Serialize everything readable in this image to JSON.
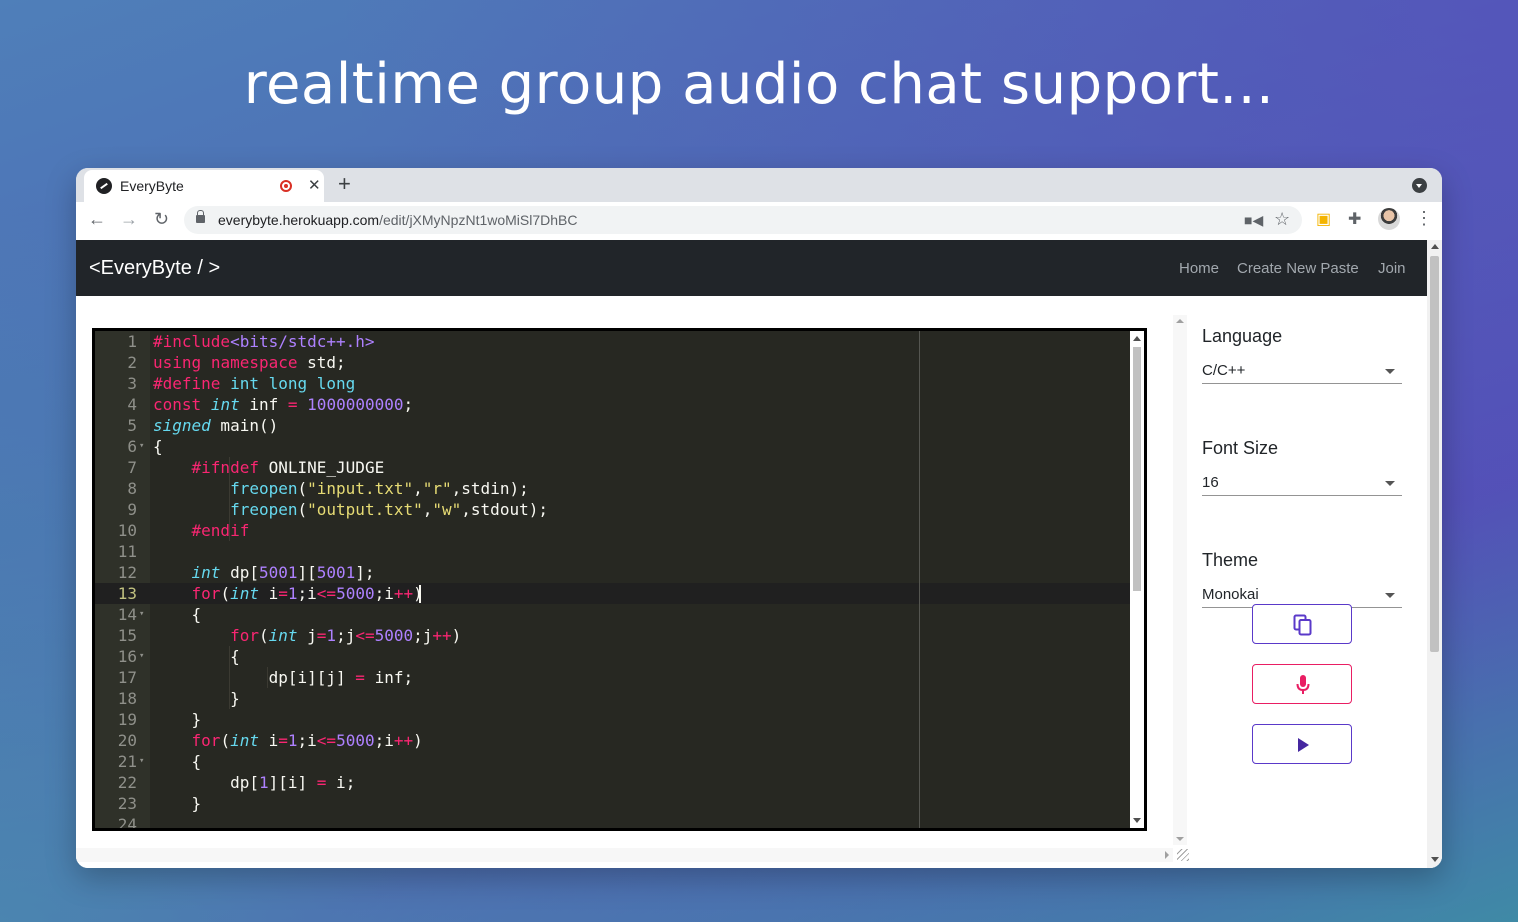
{
  "headline": "realtime group audio chat support...",
  "browser": {
    "tab_title": "EveryByte",
    "tab_close": "✕",
    "new_tab": "+",
    "url_host": "everybyte.herokuapp.com",
    "url_path": "/edit/jXMyNpzNt1woMiSl7DhBC"
  },
  "navbar": {
    "brand": "<EveryByte / >",
    "links": [
      "Home",
      "Create New Paste",
      "Join"
    ]
  },
  "editor": {
    "theme": "Monokai",
    "lines": [
      "#include<bits/stdc++.h>",
      "using namespace std;",
      "#define int long long",
      "const int inf = 1000000000;",
      "signed main()",
      "{",
      "    #ifndef ONLINE_JUDGE",
      "        freopen(\"input.txt\",\"r\",stdin);",
      "        freopen(\"output.txt\",\"w\",stdout);",
      "    #endif",
      "",
      "    int dp[5001][5001];",
      "    for(int i=1;i<=5000;i++)",
      "    {",
      "        for(int j=1;j<=5000;j++)",
      "        {",
      "            dp[i][j] = inf;",
      "        }",
      "    }",
      "    for(int i=1;i<=5000;i++)",
      "    {",
      "        dp[1][i] = i;",
      "    }",
      ""
    ],
    "fold_lines": [
      6,
      14,
      16,
      21
    ],
    "active_line": 13
  },
  "settings": {
    "language_label": "Language",
    "language_value": "C/C++",
    "font_size_label": "Font Size",
    "font_size_value": "16",
    "theme_label": "Theme",
    "theme_value": "Monokai"
  },
  "actions": [
    {
      "icon": "copy-icon",
      "color": "#5a39c9"
    },
    {
      "icon": "mic-icon",
      "color": "#e91e63"
    },
    {
      "icon": "play-icon",
      "color": "#4527a0"
    }
  ]
}
